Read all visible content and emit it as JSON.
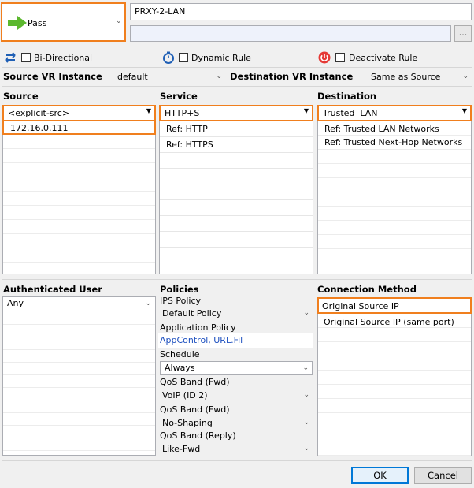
{
  "action": {
    "label": "Pass",
    "icon": "green-arrow-icon"
  },
  "rule_name": "PRXY-2-LAN",
  "description_value": "",
  "browse_label": "...",
  "options": {
    "bidirectional": "Bi-Directional",
    "dynamic_rule": "Dynamic Rule",
    "deactivate_rule": "Deactivate Rule"
  },
  "vr": {
    "source_label": "Source VR Instance",
    "source_value": "default",
    "dest_label": "Destination VR Instance",
    "dest_value": "Same as Source"
  },
  "source": {
    "heading": "Source",
    "selected": "<explicit-src>",
    "items": [
      "172.16.0.111"
    ]
  },
  "service": {
    "heading": "Service",
    "selected": "HTTP+S",
    "items": [
      "Ref: HTTP",
      "Ref: HTTPS"
    ]
  },
  "destination": {
    "heading": "Destination",
    "selected": "Trusted  LAN",
    "items": [
      "Ref: Trusted LAN Networks",
      "Ref: Trusted Next-Hop Networks"
    ]
  },
  "auth_user": {
    "heading": "Authenticated User",
    "selected": "Any"
  },
  "policies": {
    "heading": "Policies",
    "ips_label": "IPS Policy",
    "ips_value": "Default Policy",
    "app_label": "Application Policy",
    "app_value": "AppControl, URL.Fil",
    "schedule_label": "Schedule",
    "schedule_value": "Always",
    "qos_fwd_label": "QoS Band (Fwd)",
    "qos_fwd_value": "VoIP (ID 2)",
    "qos_fwd2_label": "QoS Band (Fwd)",
    "qos_fwd2_value": "No-Shaping",
    "qos_reply_label": "QoS Band (Reply)",
    "qos_reply_value": "Like-Fwd"
  },
  "connection": {
    "heading": "Connection Method",
    "items": [
      "Original Source IP",
      "Original Source IP (same port)"
    ]
  },
  "buttons": {
    "ok": "OK",
    "cancel": "Cancel"
  },
  "colors": {
    "highlight": "#f07f1e",
    "pass_arrow": "#5cb82e",
    "deactivate": "#e53935",
    "link": "#1c4fbf"
  }
}
